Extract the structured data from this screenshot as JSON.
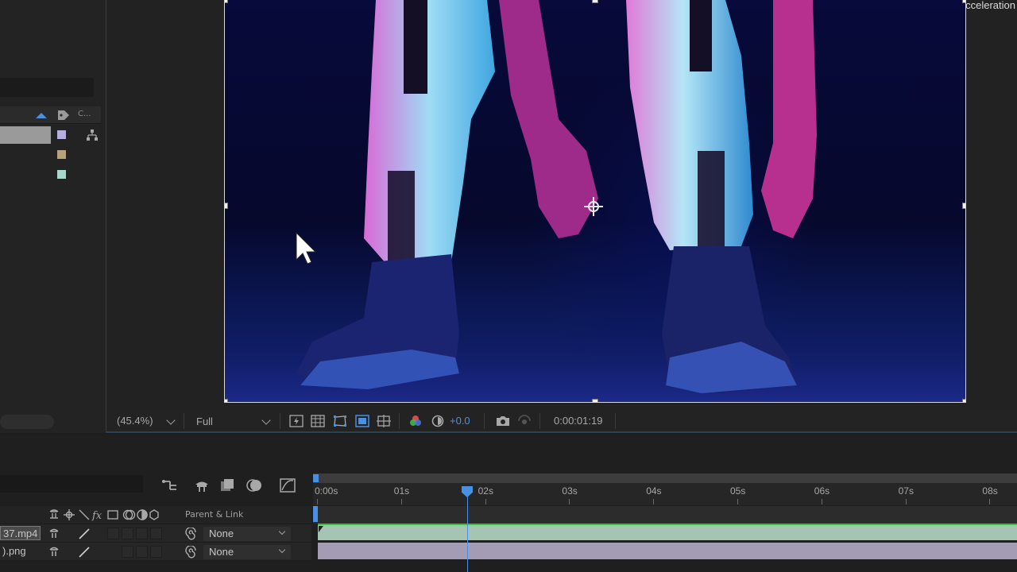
{
  "viewer": {
    "display_acceleration": "Display Acceleration",
    "zoom": "(45.4%)",
    "resolution": "Full",
    "exposure": "+0.0",
    "timecode": "0:00:01:19"
  },
  "project": {
    "column_label": "C...",
    "label_colors": [
      "#b6b0e0",
      "#b8a27a",
      "#a8d8cc"
    ]
  },
  "timeline": {
    "parent_link_header": "Parent & Link",
    "ruler": [
      "0:00s",
      "01s",
      "02s",
      "03s",
      "04s",
      "05s",
      "06s",
      "07s",
      "08s"
    ],
    "layers": [
      {
        "name": "37.mp4",
        "parent": "None"
      },
      {
        "name": ").png",
        "parent": "None"
      }
    ],
    "track_colors": {
      "video": "#a6c4b4",
      "image": "#a39cb4",
      "accent": "#4a90e2"
    }
  }
}
